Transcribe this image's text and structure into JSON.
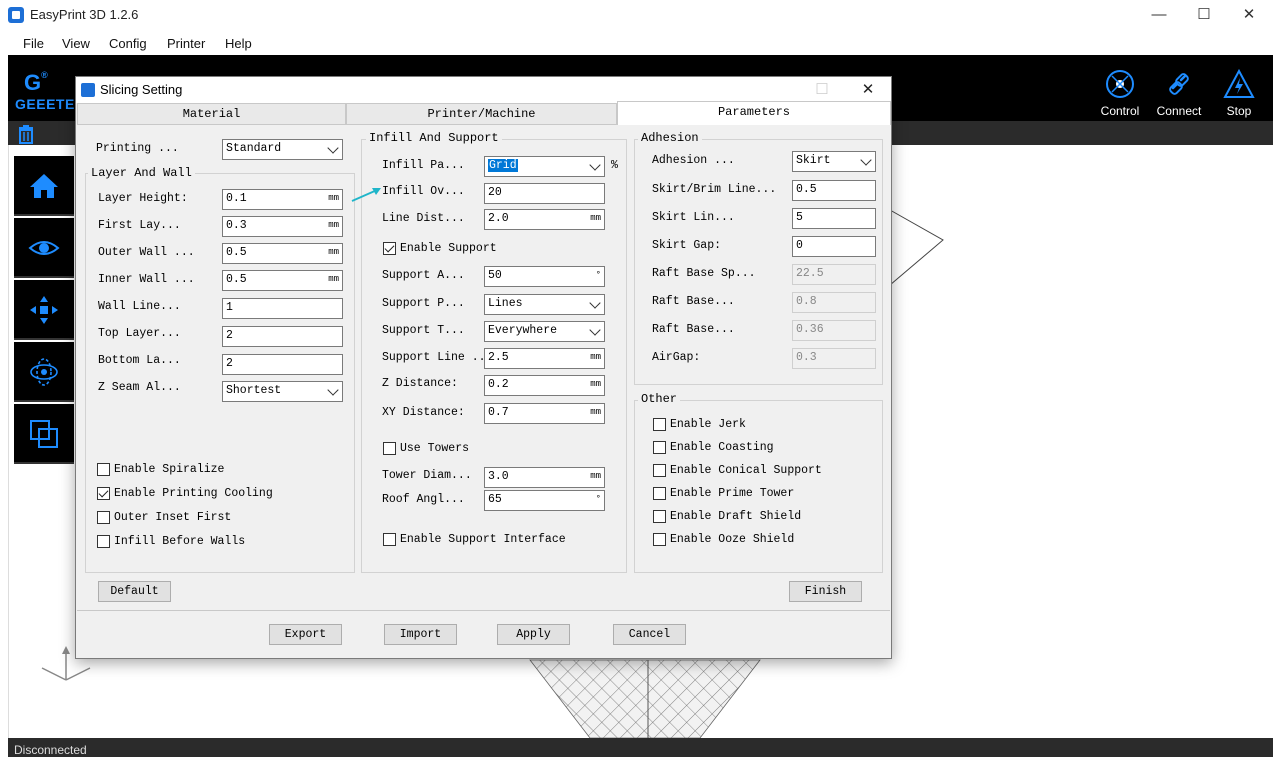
{
  "app": {
    "title": "EasyPrint 3D 1.2.6",
    "window_controls": {
      "minimize": "—",
      "maximize": "☐",
      "close": "✕"
    },
    "menu": [
      "File",
      "View",
      "Config",
      "Printer",
      "Help"
    ],
    "logo_text": "GEEETE",
    "toolbar_right": [
      {
        "label": "Control",
        "icon": "control-icon"
      },
      {
        "label": "Connect",
        "icon": "connect-icon"
      },
      {
        "label": "Stop",
        "icon": "stop-icon"
      }
    ],
    "status": "Disconnected"
  },
  "dialog": {
    "title": "Slicing Setting",
    "controls": {
      "maximize": "☐",
      "close": "✕"
    },
    "tabs": [
      {
        "label": "Material",
        "active": false
      },
      {
        "label": "Printer/Machine",
        "active": false
      },
      {
        "label": "Parameters",
        "active": true
      }
    ],
    "left": {
      "printing_label": "Printing ...",
      "printing_value": "Standard",
      "group_title": "Layer And Wall",
      "rows": [
        {
          "label": "Layer Height:",
          "value": "0.1",
          "unit": "mm"
        },
        {
          "label": "First Lay...",
          "value": "0.3",
          "unit": "mm"
        },
        {
          "label": "Outer Wall ...",
          "value": "0.5",
          "unit": "mm"
        },
        {
          "label": "Inner Wall ...",
          "value": "0.5",
          "unit": "mm"
        },
        {
          "label": "Wall Line...",
          "value": "1",
          "unit": ""
        },
        {
          "label": "Top Layer...",
          "value": "2",
          "unit": ""
        },
        {
          "label": "Bottom La...",
          "value": "2",
          "unit": ""
        }
      ],
      "zseam_label": "Z Seam Al...",
      "zseam_value": "Shortest",
      "checks": [
        {
          "label": "Enable Spiralize",
          "checked": false
        },
        {
          "label": "Enable Printing Cooling",
          "checked": true
        },
        {
          "label": "Outer Inset First",
          "checked": false
        },
        {
          "label": "Infill Before Walls",
          "checked": false
        }
      ],
      "default_button": "Default"
    },
    "middle": {
      "group_title": "Infill And Support",
      "infill_pattern_label": "Infill Pa...",
      "infill_pattern_value": "Grid",
      "percent_sign": "%",
      "infill_overlap_label": "Infill Ov...",
      "infill_overlap_value": "20",
      "line_dist_label": "Line Dist...",
      "line_dist_value": "2.0",
      "line_dist_unit": "mm",
      "enable_support_label": "Enable Support",
      "enable_support_checked": true,
      "support_angle_label": "Support A...",
      "support_angle_value": "50",
      "degree": "°",
      "support_pattern_label": "Support P...",
      "support_pattern_value": "Lines",
      "support_type_label": "Support T...",
      "support_type_value": "Everywhere",
      "support_line_label": "Support Line ...",
      "support_line_value": "2.5",
      "z_distance_label": "Z Distance:",
      "z_distance_value": "0.2",
      "xy_distance_label": "XY Distance:",
      "xy_distance_value": "0.7",
      "unit_mm": "mm",
      "use_towers_label": "Use Towers",
      "use_towers_checked": false,
      "tower_diam_label": "Tower Diam...",
      "tower_diam_value": "3.0",
      "roof_angle_label": "Roof Angl...",
      "roof_angle_value": "65",
      "support_interface_label": "Enable Support Interface",
      "support_interface_checked": false
    },
    "right": {
      "adhesion_title": "Adhesion",
      "adhesion_label": "Adhesion ...",
      "adhesion_value": "Skirt",
      "rows": [
        {
          "label": "Skirt/Brim Line...",
          "value": "0.5",
          "disabled": false
        },
        {
          "label": "Skirt Lin...",
          "value": "5",
          "disabled": false
        },
        {
          "label": "Skirt Gap:",
          "value": "0",
          "disabled": false
        },
        {
          "label": "Raft Base Sp...",
          "value": "22.5",
          "disabled": true
        },
        {
          "label": "Raft Base...",
          "value": "0.8",
          "disabled": true
        },
        {
          "label": "Raft Base...",
          "value": "0.36",
          "disabled": true
        },
        {
          "label": "AirGap:",
          "value": "0.3",
          "disabled": true
        }
      ],
      "other_title": "Other",
      "other_checks": [
        {
          "label": "Enable Jerk",
          "checked": false
        },
        {
          "label": "Enable Coasting",
          "checked": false
        },
        {
          "label": "Enable Conical Support",
          "checked": false
        },
        {
          "label": "Enable Prime Tower",
          "checked": false
        },
        {
          "label": "Enable Draft Shield",
          "checked": false
        },
        {
          "label": "Enable Ooze Shield",
          "checked": false
        }
      ],
      "finish_button": "Finish"
    },
    "footer_buttons": [
      "Export",
      "Import",
      "Apply",
      "Cancel"
    ]
  },
  "colors": {
    "accent": "#1e8cff",
    "annotation_arrow": "#1fb5c9",
    "selection": "#0078d7"
  }
}
